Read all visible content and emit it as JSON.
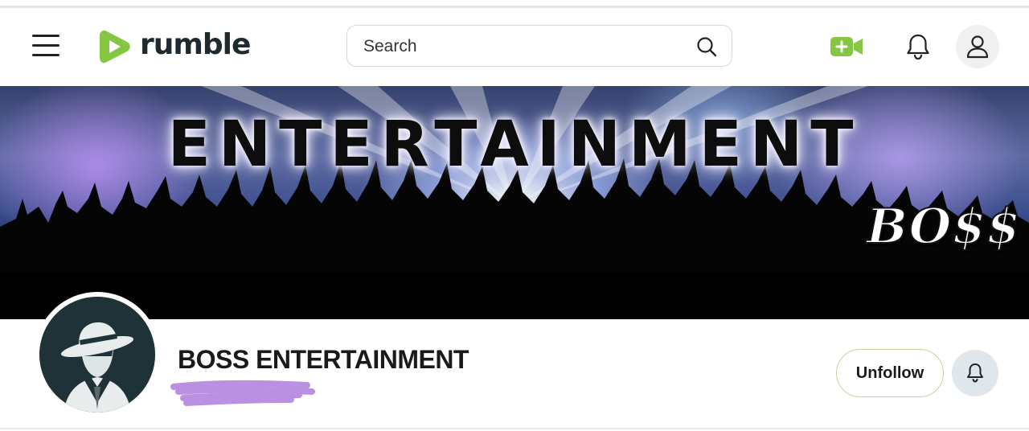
{
  "header": {
    "logo_text": "rumble",
    "search": {
      "placeholder": "Search"
    },
    "icons": {
      "menu": "hamburger-menu-icon",
      "search": "search-icon",
      "go_live": "video-camera-plus-icon",
      "notifications": "bell-icon",
      "account": "user-icon"
    },
    "brand_color": "#85c742"
  },
  "banner": {
    "title": "ENTERTAINMENT",
    "signature": "BO$$"
  },
  "channel": {
    "name": "BOSS ENTERTAINMENT",
    "follow_button_label": "Unfollow",
    "notify_icon": "bell-icon",
    "redaction_color": "#b58ae0"
  }
}
